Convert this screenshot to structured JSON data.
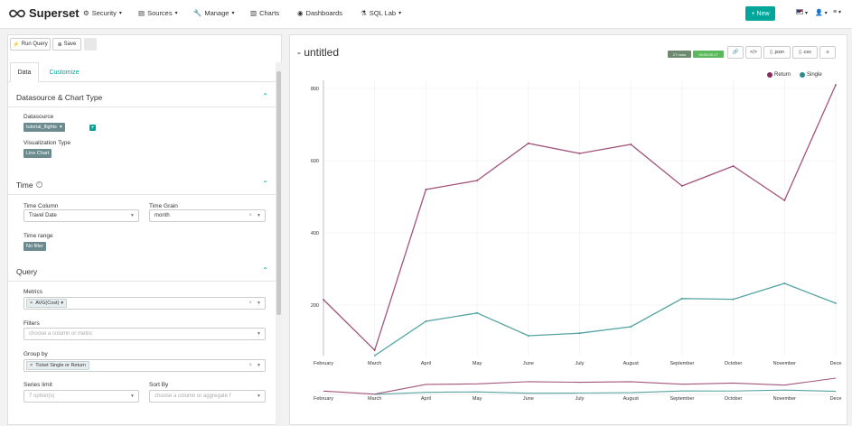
{
  "navbar": {
    "brand": "Superset",
    "items": [
      {
        "label": "Security",
        "icon": "gear-icon"
      },
      {
        "label": "Sources",
        "icon": "database-icon"
      },
      {
        "label": "Manage",
        "icon": "wrench-icon"
      },
      {
        "label": "Charts",
        "icon": "bar-chart-icon"
      },
      {
        "label": "Dashboards",
        "icon": "dashboard-icon"
      },
      {
        "label": "SQL Lab",
        "icon": "flask-icon"
      }
    ],
    "new_label": "New"
  },
  "toolbar": {
    "run_query": "Run Query",
    "save": "Save"
  },
  "tabs": [
    "Data",
    "Customize"
  ],
  "sections": {
    "datasource": {
      "title": "Datasource & Chart Type",
      "datasource_label": "Datasource",
      "datasource_value": "tutorial_flights",
      "viz_label": "Visualization Type",
      "viz_value": "Line Chart"
    },
    "time": {
      "title": "Time",
      "time_column_label": "Time Column",
      "time_column_value": "Travel Date",
      "time_grain_label": "Time Grain",
      "time_grain_value": "month",
      "time_range_label": "Time range",
      "time_range_value": "No filter"
    },
    "query": {
      "title": "Query",
      "metrics_label": "Metrics",
      "metrics_value": "AVG(Cost)",
      "filters_label": "Filters",
      "filters_placeholder": "choose a column or metric",
      "groupby_label": "Group by",
      "groupby_value": "Ticket Single or Return",
      "series_limit_label": "Series limit",
      "series_limit_placeholder": "7 option(s)",
      "sort_by_label": "Sort By",
      "sort_by_placeholder": "choose a column or aggregate f"
    }
  },
  "chart_panel": {
    "title": "- untitled",
    "rows_badge": "27 rows",
    "time_badge": "00:00:00.17",
    "buttons": [
      ".json",
      ".csv"
    ]
  },
  "chart_data": {
    "type": "line",
    "categories": [
      "February",
      "March",
      "April",
      "May",
      "June",
      "July",
      "August",
      "September",
      "October",
      "November",
      "December"
    ],
    "series": [
      {
        "name": "Return",
        "color": "#8b2b5b",
        "values": [
          215,
          75,
          520,
          545,
          648,
          620,
          645,
          530,
          585,
          490,
          810
        ]
      },
      {
        "name": "Single",
        "color": "#2a8c8c",
        "values": [
          null,
          60,
          155,
          178,
          115,
          122,
          140,
          218,
          216,
          260,
          205
        ]
      }
    ],
    "y_ticks": [
      200,
      400,
      600,
      800
    ],
    "ylim": [
      60,
      810
    ],
    "tick_labels": [
      "February",
      "March",
      "April",
      "May",
      "June",
      "July",
      "August",
      "September",
      "October",
      "November",
      "Dece"
    ],
    "grid": true,
    "legend_position": "top-right"
  },
  "colors": {
    "accent": "#00a699",
    "return_series": "#8b2b5b",
    "single_series": "#2a8c8c"
  }
}
